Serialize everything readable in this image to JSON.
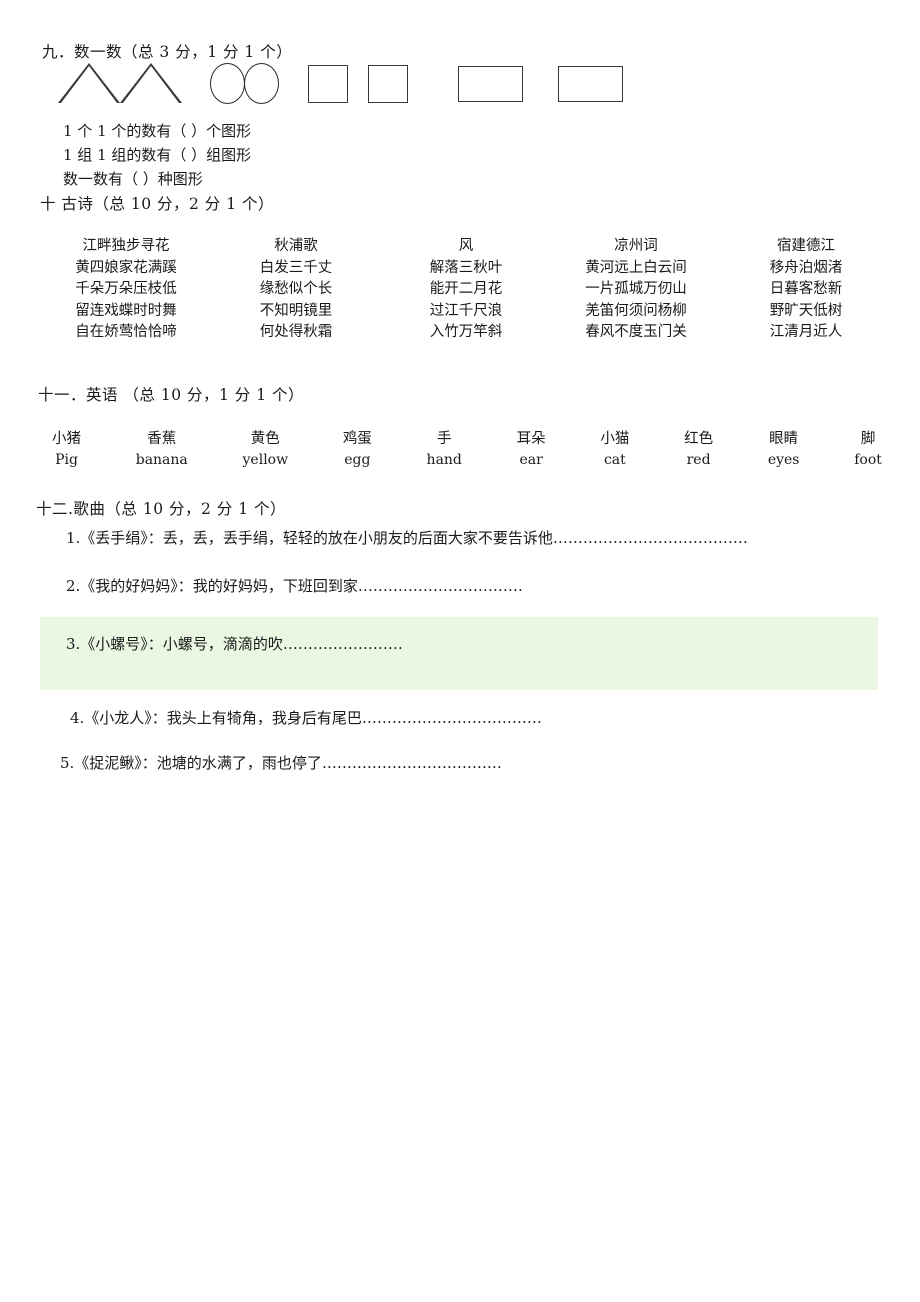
{
  "document": {
    "sections": {
      "counting": {
        "heading": "九．数一数（总 3 分，1 分 1 个）",
        "shapes": [
          {
            "kind": "triangle",
            "name": "triangle-shape-1"
          },
          {
            "kind": "triangle",
            "name": "triangle-shape-2"
          },
          {
            "kind": "ellipse",
            "name": "ellipse-shape-1"
          },
          {
            "kind": "ellipse",
            "name": "ellipse-shape-2"
          },
          {
            "kind": "square",
            "name": "square-shape-1"
          },
          {
            "kind": "square",
            "name": "square-shape-2"
          },
          {
            "kind": "rectangle",
            "name": "rectangle-shape-1"
          },
          {
            "kind": "rectangle",
            "name": "rectangle-shape-2"
          }
        ],
        "questions": [
          "1 个 1 个的数有（          ）个图形",
          "1 组 1 组的数有（          ）组图形",
          "数一数有（        ）种图形"
        ]
      },
      "poetry": {
        "heading": "十  古诗（总 10 分，2 分 1 个）",
        "poems": [
          {
            "title": "江畔独步寻花",
            "lines": [
              "黄四娘家花满蹊",
              "千朵万朵压枝低",
              "留连戏蝶时时舞",
              "自在娇莺恰恰啼"
            ]
          },
          {
            "title": "秋浦歌",
            "lines": [
              "白发三千丈",
              "缘愁似个长",
              "不知明镜里",
              "何处得秋霜"
            ]
          },
          {
            "title": "风",
            "lines": [
              "解落三秋叶",
              "能开二月花",
              "过江千尺浪",
              "入竹万竿斜"
            ]
          },
          {
            "title": "凉州词",
            "lines": [
              "黄河远上白云间",
              "一片孤城万仞山",
              "羌笛何须问杨柳",
              "春风不度玉门关"
            ]
          },
          {
            "title": "宿建德江",
            "lines": [
              "移舟泊烟渚",
              "日暮客愁新",
              "野旷天低树",
              "江清月近人"
            ]
          }
        ]
      },
      "english": {
        "heading": "十一．英语 （总 10 分，1 分 1 个）",
        "words": [
          {
            "cn": "小猪",
            "en": "Pig"
          },
          {
            "cn": "香蕉",
            "en": "banana"
          },
          {
            "cn": "黄色",
            "en": "yellow"
          },
          {
            "cn": "鸡蛋",
            "en": "egg"
          },
          {
            "cn": "手",
            "en": "hand"
          },
          {
            "cn": "耳朵",
            "en": "ear"
          },
          {
            "cn": "小猫",
            "en": "cat"
          },
          {
            "cn": "红色",
            "en": "red"
          },
          {
            "cn": "眼睛",
            "en": "eyes"
          },
          {
            "cn": "脚",
            "en": "foot"
          }
        ]
      },
      "songs": {
        "heading": "十二.歌曲（总 10 分，2 分 1 个）",
        "highlight_color": "#eaf7e2",
        "items": [
          "1.《丢手绢》：丢，丢，丢手绢，轻轻的放在小朋友的后面大家不要告诉他…………………………………",
          "2.《我的好妈妈》：我的好妈妈，下班回到家……………………………",
          "3.《小螺号》：小螺号，滴滴的吹……………………",
          "4.《小龙人》：我头上有犄角，我身后有尾巴………………………………",
          "5.《捉泥鳅》：池塘的水满了，雨也停了………………………………"
        ]
      }
    }
  }
}
